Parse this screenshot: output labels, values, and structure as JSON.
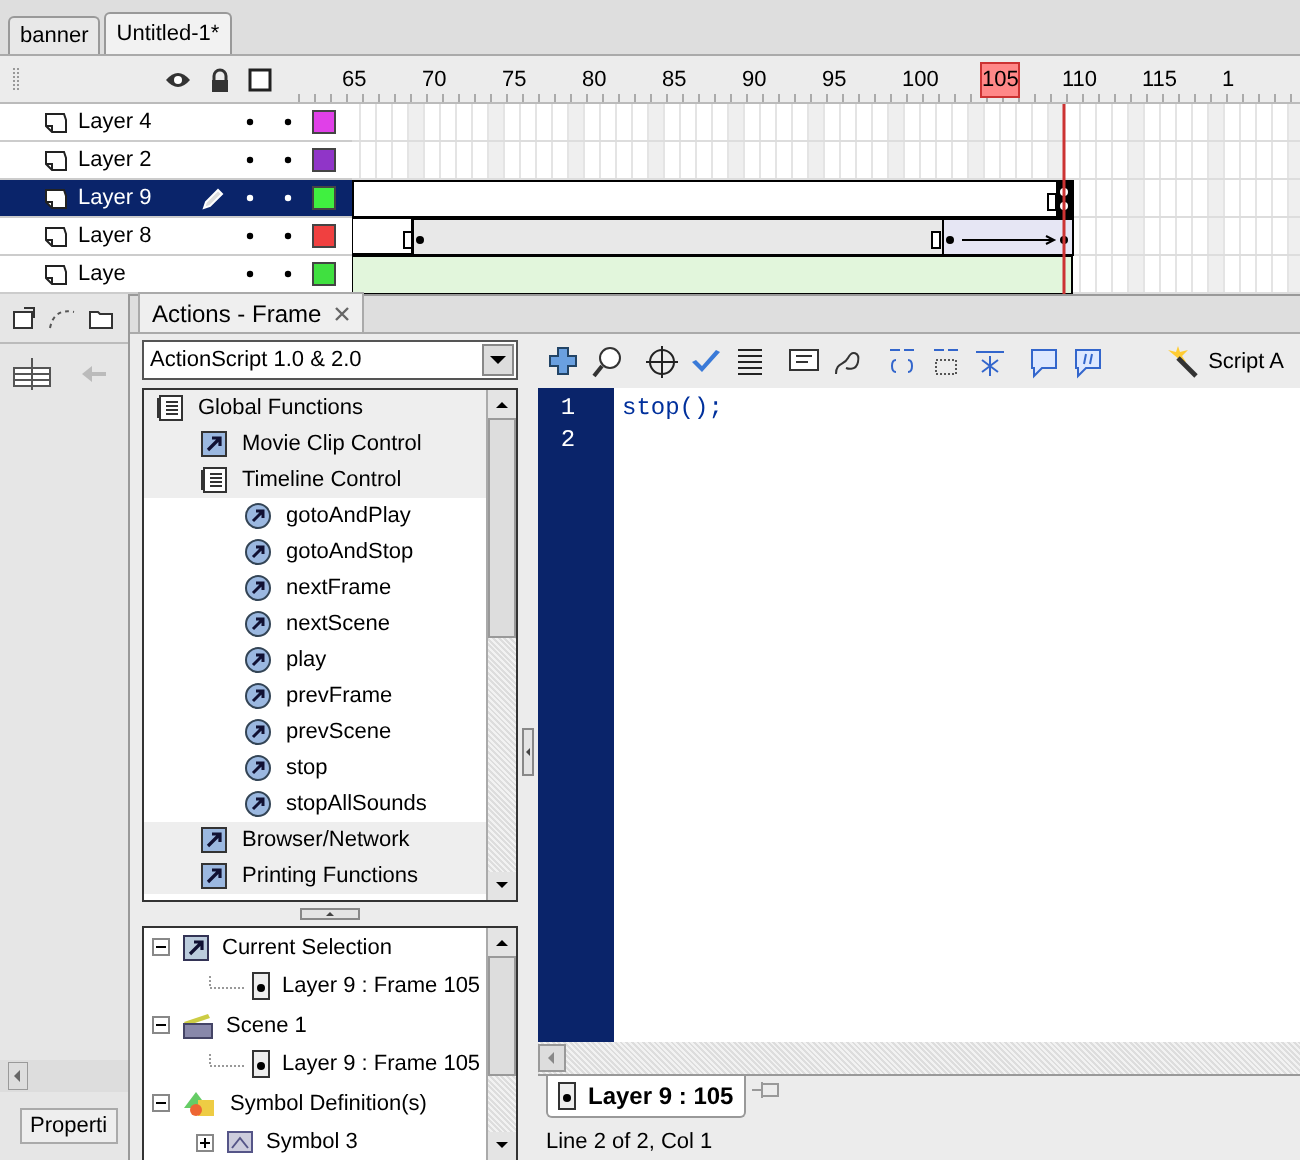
{
  "document_tabs": [
    {
      "label": "banner",
      "selected": false
    },
    {
      "label": "Untitled-1*",
      "selected": true
    }
  ],
  "timeline": {
    "ruler": [
      {
        "label": "65",
        "current": false
      },
      {
        "label": "70",
        "current": false
      },
      {
        "label": "75",
        "current": false
      },
      {
        "label": "80",
        "current": false
      },
      {
        "label": "85",
        "current": false
      },
      {
        "label": "90",
        "current": false
      },
      {
        "label": "95",
        "current": false
      },
      {
        "label": "100",
        "current": false
      },
      {
        "label": "105",
        "current": true
      },
      {
        "label": "110",
        "current": false
      },
      {
        "label": "115",
        "current": false
      },
      {
        "label": "1",
        "current": false
      }
    ],
    "layers": [
      {
        "name": "Layer 4",
        "color": "#e040e8",
        "selected": false
      },
      {
        "name": "Layer 2",
        "color": "#9035c8",
        "selected": false
      },
      {
        "name": "Layer 9",
        "color": "#40f040",
        "selected": true
      },
      {
        "name": "Layer 8",
        "color": "#f04040",
        "selected": false
      },
      {
        "name": "Laye",
        "color": "#40e040",
        "selected": false
      }
    ]
  },
  "actions_panel": {
    "title": "Actions - Frame",
    "language": "ActionScript 1.0 & 2.0",
    "toolbox": [
      {
        "label": "Global Functions",
        "kind": "book",
        "expanded": true,
        "children": [
          {
            "label": "Movie Clip Control",
            "kind": "book",
            "expanded": false
          },
          {
            "label": "Timeline Control",
            "kind": "book",
            "expanded": true,
            "children": [
              {
                "label": "gotoAndPlay",
                "kind": "action"
              },
              {
                "label": "gotoAndStop",
                "kind": "action"
              },
              {
                "label": "nextFrame",
                "kind": "action"
              },
              {
                "label": "nextScene",
                "kind": "action"
              },
              {
                "label": "play",
                "kind": "action"
              },
              {
                "label": "prevFrame",
                "kind": "action"
              },
              {
                "label": "prevScene",
                "kind": "action"
              },
              {
                "label": "stop",
                "kind": "action"
              },
              {
                "label": "stopAllSounds",
                "kind": "action"
              }
            ]
          },
          {
            "label": "Browser/Network",
            "kind": "book",
            "expanded": false
          },
          {
            "label": "Printing Functions",
            "kind": "book",
            "expanded": false
          }
        ]
      }
    ],
    "script_navigator": [
      {
        "label": "Current Selection",
        "kind": "selection",
        "expanded": true,
        "children": [
          {
            "label": "Layer 9 : Frame 105",
            "kind": "frame"
          }
        ]
      },
      {
        "label": "Scene 1",
        "kind": "scene",
        "expanded": true,
        "children": [
          {
            "label": "Layer 9 : Frame 105",
            "kind": "frame"
          }
        ]
      },
      {
        "label": "Symbol Definition(s)",
        "kind": "symbols",
        "expanded": true,
        "children": [
          {
            "label": "Symbol 3",
            "kind": "symbol",
            "expanded": false
          }
        ]
      }
    ],
    "script_assist": "Script A",
    "line_numbers": [
      "1",
      "2"
    ],
    "code": [
      "stop();"
    ],
    "script_tab": "Layer 9 : 105",
    "status": "Line 2 of 2, Col 1"
  },
  "properties_tab": "Properti"
}
